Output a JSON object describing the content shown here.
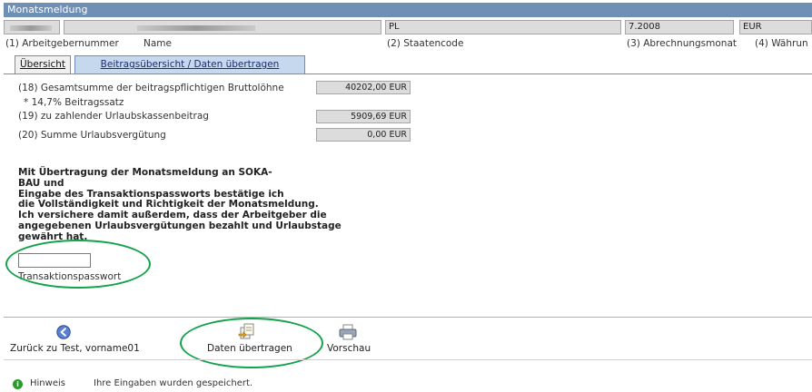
{
  "window": {
    "title": "Monatsmeldung"
  },
  "header": {
    "fields": {
      "staatencode_value": "PL",
      "abrechnungsmonat_value": "7.2008",
      "waehrung_value": "EUR"
    },
    "labels": {
      "arbeitgebernummer": "(1) Arbeitgebernummer",
      "name": "Name",
      "staatencode": "(2) Staatencode",
      "abrechnungsmonat": "(3) Abrechnungsmonat",
      "waehrung": "(4) Währun"
    }
  },
  "tabs": [
    {
      "label": "Übersicht",
      "active": false
    },
    {
      "label": "Beitragsübersicht / Daten übertragen",
      "active": true
    }
  ],
  "summary": {
    "row18_label": "(18) Gesamtsumme der beitragspflichtigen Bruttolöhne",
    "row18_value": "40202,00 EUR",
    "rate_label": "* 14,7% Beitragssatz",
    "row19_label": "(19) zu zahlender Urlaubskassenbeitrag",
    "row19_value": "5909,69 EUR",
    "row20_label": "(20) Summe Urlaubsvergütung",
    "row20_value": "0,00 EUR"
  },
  "confirmation": {
    "lines": [
      "Mit Übertragung der Monatsmeldung an SOKA-",
      "BAU und",
      "Eingabe des Transaktionspassworts bestätige ich",
      "die Vollständigkeit und Richtigkeit der Monatsmeldung.",
      "Ich versichere damit außerdem, dass der Arbeitgeber die",
      "angegebenen Urlaubsvergütungen bezahlt und Urlaubstage",
      "gewährt hat."
    ],
    "password_label": "Transaktionspasswort",
    "password_value": ""
  },
  "toolbar": {
    "back_label": "Zurück zu Test, vorname01",
    "submit_label": "Daten übertragen",
    "preview_label": "Vorschau"
  },
  "status": {
    "label": "Hinweis",
    "message": "Ihre Eingaben wurden gespeichert."
  },
  "colors": {
    "titlebar": "#6f8fb4",
    "active_tab": "#c6d8ee",
    "highlight_ring": "#12a34a",
    "hint_icon": "#2a9a2a"
  },
  "icons": {
    "back": "arrow-left-circle",
    "submit": "transfer-documents",
    "preview": "printer",
    "hint": "info-circle"
  }
}
